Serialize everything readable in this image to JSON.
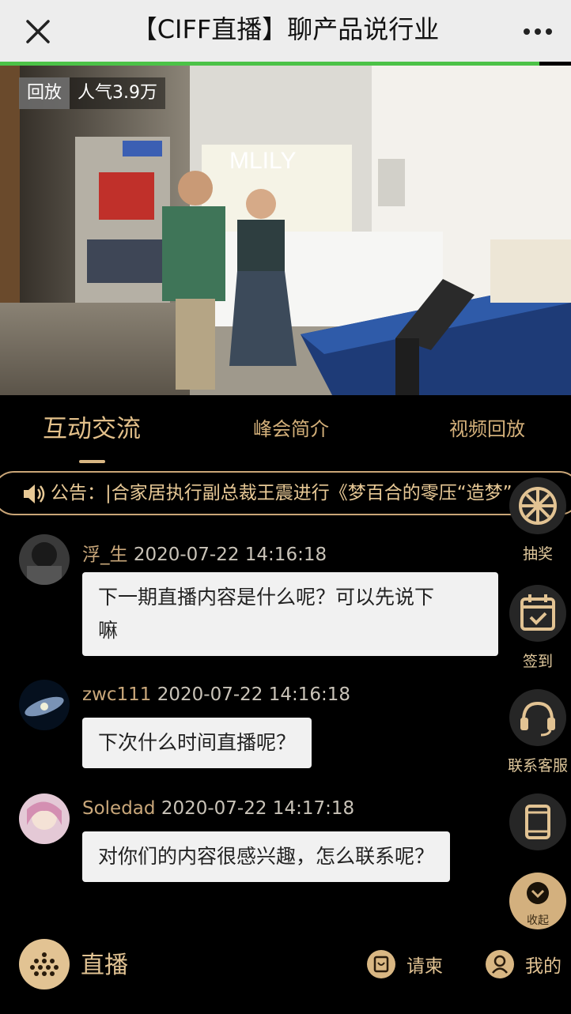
{
  "header": {
    "title": "【CIFF直播】聊产品说行业",
    "close_icon": "close-icon",
    "more_icon": "more-dots-icon"
  },
  "player": {
    "progress_fraction": 0.944,
    "replay_label": "回放",
    "popularity_label": "人气3.9万"
  },
  "tabs": [
    {
      "label": "互动交流",
      "active": true
    },
    {
      "label": "峰会简介",
      "active": false
    },
    {
      "label": "视频回放",
      "active": false
    }
  ],
  "notice": {
    "icon": "speaker-icon",
    "text": "公告：|合家居执行副总裁王震进行《梦百合的零压“造梦”"
  },
  "messages": [
    {
      "user": "浮_生",
      "time": "2020-07-22 14:16:18",
      "lines": [
        "下一期直播内容是什么呢？可以先说下",
        "嘛"
      ]
    },
    {
      "user": "zwc111",
      "time": "2020-07-22 14:16:18",
      "lines": [
        "下次什么时间直播呢？"
      ]
    },
    {
      "user": "Soledad",
      "time": "2020-07-22 14:17:18",
      "lines": [
        "对你们的内容很感兴趣，怎么联系呢？"
      ]
    }
  ],
  "side_buttons": [
    {
      "icon": "lottery-wheel-icon",
      "label": "抽奖"
    },
    {
      "icon": "calendar-check-icon",
      "label": "签到"
    },
    {
      "icon": "headset-icon",
      "label": "联系客服"
    },
    {
      "icon": "tablet-icon",
      "label": ""
    }
  ],
  "collapse": {
    "icon": "chevron-down-icon",
    "label": "收起"
  },
  "bottom": {
    "keyboard_icon": "keyboard-icon",
    "live_label": "直播",
    "invite_label": "请柬",
    "invite_icon": "invitation-icon",
    "mine_label": "我的",
    "mine_icon": "user-icon"
  },
  "colors": {
    "accent_gold": "#d9b783",
    "progress_green": "#4cc247",
    "background": "#000000"
  }
}
